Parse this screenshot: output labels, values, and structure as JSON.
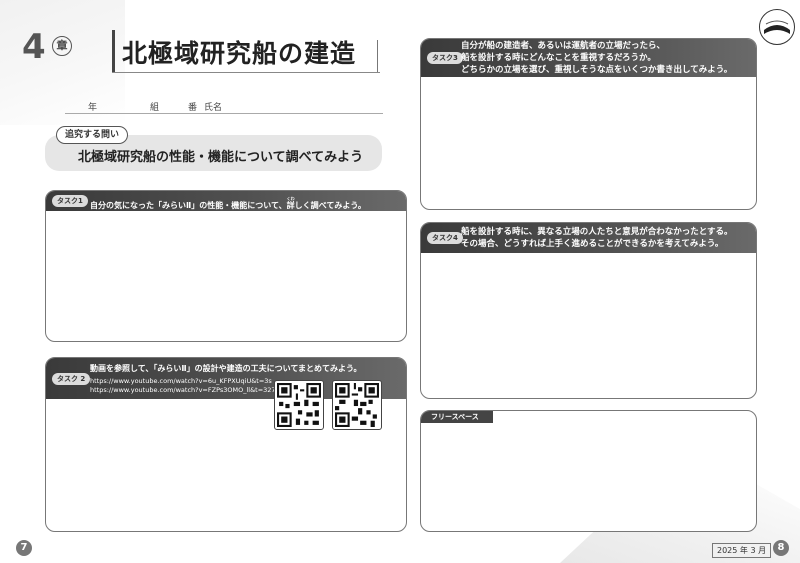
{
  "chapter": {
    "number": "4",
    "kanji": "章"
  },
  "title": "北極域研究船の建造",
  "student_fields": {
    "year": "年",
    "class": "組",
    "number": "番",
    "name": "氏名"
  },
  "question": {
    "tag": "追究する問い",
    "text": "北極域研究船の性能・機能について調べてみよう"
  },
  "task1": {
    "label": "タスク1",
    "text": "自分の気になった「みらいⅡ」の性能・機能について、詳しく調べてみよう。",
    "ruby": "くわ"
  },
  "task2": {
    "label": "タスク 2",
    "text": "動画を参照して、「みらいⅡ」の設計や建造の工夫についてまとめてみよう。",
    "urls": [
      "https://www.youtube.com/watch?v=6u_KFPXUqiU&t=3s",
      "https://www.youtube.com/watch?v=FZPs3OMO_ll&t=327s"
    ]
  },
  "task3": {
    "label": "タスク3",
    "lines": [
      "自分が船の建造者、あるいは運航者の立場だったら、",
      "船を設計する時にどんなことを重視するだろうか。",
      "どちらかの立場を選び、重視しそうな点をいくつか書き出してみよう。"
    ]
  },
  "task4": {
    "label": "タスク4",
    "lines": [
      "船を設計する時に、異なる立場の人たちと意見が合わなかったとする。",
      "その場合、どうすれば上手く進めることができるかを考えてみよう。"
    ]
  },
  "free_space": {
    "label": "フリースペース"
  },
  "footer": {
    "left_page": "7",
    "right_page": "8",
    "date": "2025 年 3 月"
  }
}
